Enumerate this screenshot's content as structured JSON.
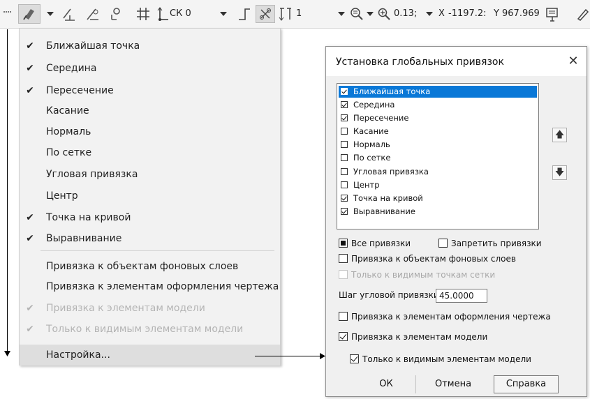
{
  "toolbar": {
    "coordinate_system": "СК 0",
    "step_value": "1",
    "zoom_value": "0.13;",
    "x_label": "X",
    "x_value": "-1197.2:",
    "y_label": "Y",
    "y_value": "967.969"
  },
  "snap_menu": {
    "items": [
      {
        "label": "Ближайшая точка",
        "check": "✔"
      },
      {
        "label": "Середина",
        "check": "✔"
      },
      {
        "label": "Пересечение",
        "check": "✔"
      },
      {
        "label": "Касание",
        "check": ""
      },
      {
        "label": "Нормаль",
        "check": ""
      },
      {
        "label": "По сетке",
        "check": ""
      },
      {
        "label": "Угловая привязка",
        "check": ""
      },
      {
        "label": "Центр",
        "check": ""
      },
      {
        "label": "Точка на кривой",
        "check": "✔"
      },
      {
        "label": "Выравнивание",
        "check": "✔"
      },
      {
        "label": "Привязка к объектам фоновых слоев",
        "check": ""
      },
      {
        "label": "Привязка к элементам оформления чертежа",
        "check": ""
      },
      {
        "label": "Привязка к элементам модели",
        "check": "✔"
      },
      {
        "label": "Только к видимым элементам модели",
        "check": "✔"
      },
      {
        "label": "Настройка...",
        "check": ""
      }
    ]
  },
  "dialog": {
    "title": "Установка глобальных привязок",
    "close": "✕",
    "list_items": [
      {
        "label": "Ближайшая точка",
        "checked": true,
        "selected": true
      },
      {
        "label": "Середина",
        "checked": true,
        "selected": false
      },
      {
        "label": "Пересечение",
        "checked": true,
        "selected": false
      },
      {
        "label": "Касание",
        "checked": false,
        "selected": false
      },
      {
        "label": "Нормаль",
        "checked": false,
        "selected": false
      },
      {
        "label": "По сетке",
        "checked": false,
        "selected": false
      },
      {
        "label": "Угловая привязка",
        "checked": false,
        "selected": false
      },
      {
        "label": "Центр",
        "checked": false,
        "selected": false
      },
      {
        "label": "Точка на кривой",
        "checked": true,
        "selected": false
      },
      {
        "label": "Выравнивание",
        "checked": true,
        "selected": false
      }
    ],
    "move_up": "🡅",
    "move_down": "🡇",
    "all_snaps": "Все привязки",
    "forbid_snaps": "Запретить привязки",
    "background_layers": "Привязка к объектам фоновых слоев",
    "visible_grid_only": "Только к видимым точкам сетки",
    "angle_step_label": "Шаг угловой привязки",
    "angle_step_value": "45.0000",
    "drawing_design": "Привязка к элементам оформления чертежа",
    "model_elements": "Привязка к элементам модели",
    "visible_model_only": "Только к видимым элементам модели",
    "ok": "ОК",
    "cancel": "Отмена",
    "help": "Справка"
  }
}
